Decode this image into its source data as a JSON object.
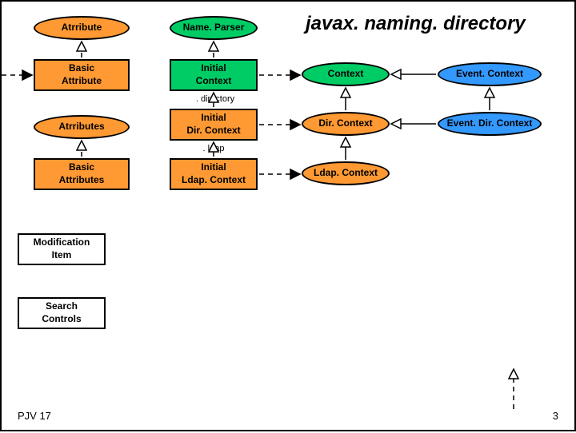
{
  "title": "javax. naming. directory",
  "footer": {
    "left": "PJV 17",
    "right": "3"
  },
  "pkg": {
    "directory": ". directory",
    "ldap": ". ldap"
  },
  "nodes": {
    "attribute": "Atrribute",
    "nameparser": "Name. Parser",
    "basic_attribute_top": "Basic",
    "basic_attribute_bot": "Attribute",
    "initial_context_top": "Initial",
    "initial_context_bot": "Context",
    "context": "Context",
    "event_context": "Event. Context",
    "attributes": "Atrributes",
    "initial_dircontext_top": "Initial",
    "initial_dircontext_bot": "Dir. Context",
    "dircontext": "Dir. Context",
    "event_dircontext": "Event. Dir. Context",
    "basic_attributes_top": "Basic",
    "basic_attributes_bot": "Attributes",
    "initial_ldapcontext_top": "Initial",
    "initial_ldapcontext_bot": "Ldap. Context",
    "ldapcontext": "Ldap. Context",
    "modification_item_top": "Modification",
    "modification_item_bot": "Item",
    "search_controls_top": "Search",
    "search_controls_bot": "Controls"
  }
}
